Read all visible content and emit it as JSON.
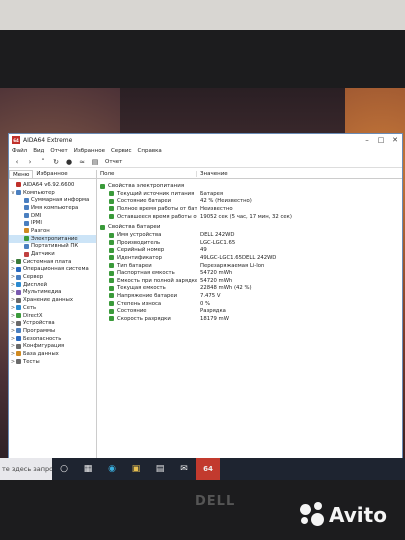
{
  "window": {
    "title": "AIDA64 Extreme",
    "app_icon_text": "64",
    "minimize": "–",
    "maximize": "□",
    "close": "✕"
  },
  "menu": [
    "Файл",
    "Вид",
    "Отчет",
    "Избранное",
    "Сервис",
    "Справка"
  ],
  "toolbar": {
    "report_label": "Отчет"
  },
  "left_tabs": [
    "Меню",
    "Избранное"
  ],
  "tree": [
    {
      "label": "AIDA64 v6.92.6600",
      "level": 0,
      "expander": "",
      "color": "#c0302a"
    },
    {
      "label": "Компьютер",
      "level": 0,
      "expander": "v",
      "color": "#4a7fc0"
    },
    {
      "label": "Суммарная информа",
      "level": 1,
      "expander": "",
      "color": "#4a7fc0"
    },
    {
      "label": "Имя компьютера",
      "level": 1,
      "expander": "",
      "color": "#4a7fc0"
    },
    {
      "label": "DMI",
      "level": 1,
      "expander": "",
      "color": "#4a7fc0"
    },
    {
      "label": "IPMI",
      "level": 1,
      "expander": "",
      "color": "#4a7fc0"
    },
    {
      "label": "Разгон",
      "level": 1,
      "expander": "",
      "color": "#d08a20"
    },
    {
      "label": "Электропитание",
      "level": 1,
      "expander": "",
      "color": "#3a9a3a",
      "selected": true
    },
    {
      "label": "Портативный ПК",
      "level": 1,
      "expander": "",
      "color": "#4a7fc0"
    },
    {
      "label": "Датчики",
      "level": 1,
      "expander": "",
      "color": "#c04040"
    },
    {
      "label": "Системная плата",
      "level": 0,
      "expander": ">",
      "color": "#3a7a3a"
    },
    {
      "label": "Операционная система",
      "level": 0,
      "expander": ">",
      "color": "#2a6ac0"
    },
    {
      "label": "Сервер",
      "level": 0,
      "expander": ">",
      "color": "#4a7fc0"
    },
    {
      "label": "Дисплей",
      "level": 0,
      "expander": ">",
      "color": "#2a8ad0"
    },
    {
      "label": "Мультимедиа",
      "level": 0,
      "expander": ">",
      "color": "#7a5ab0"
    },
    {
      "label": "Хранение данных",
      "level": 0,
      "expander": ">",
      "color": "#6a6a6a"
    },
    {
      "label": "Сеть",
      "level": 0,
      "expander": ">",
      "color": "#2a8ad0"
    },
    {
      "label": "DirectX",
      "level": 0,
      "expander": ">",
      "color": "#3a9a3a"
    },
    {
      "label": "Устройства",
      "level": 0,
      "expander": ">",
      "color": "#6a6a6a"
    },
    {
      "label": "Программы",
      "level": 0,
      "expander": ">",
      "color": "#4a7fc0"
    },
    {
      "label": "Безопасность",
      "level": 0,
      "expander": ">",
      "color": "#2a6ac0"
    },
    {
      "label": "Конфигурация",
      "level": 0,
      "expander": ">",
      "color": "#6a6a6a"
    },
    {
      "label": "База данных",
      "level": 0,
      "expander": ">",
      "color": "#d08a20"
    },
    {
      "label": "Тесты",
      "level": 0,
      "expander": ">",
      "color": "#6a6a6a"
    }
  ],
  "columns": {
    "field": "Поле",
    "value": "Значение"
  },
  "sections": [
    {
      "title": "Свойства электропитания",
      "rows": [
        {
          "field": "Текущий источник питания",
          "value": "Батарея"
        },
        {
          "field": "Состояние батареи",
          "value": "42 % (Неизвестно)"
        },
        {
          "field": "Полное время работы от бат",
          "value": "Неизвестно"
        },
        {
          "field": "Оставшееся время работы от",
          "value": "19052 сек (5 час, 17 мин, 32 сек)"
        }
      ]
    },
    {
      "title": "Свойства батареи",
      "rows": [
        {
          "field": "Имя устройства",
          "value": "DELL 242WD"
        },
        {
          "field": "Производитель",
          "value": "LGC-LGC1.65"
        },
        {
          "field": "Серийный номер",
          "value": "49"
        },
        {
          "field": "Идентификатор",
          "value": "49LGC-LGC1.65DELL 242WD"
        },
        {
          "field": "Тип батареи",
          "value": "Перезаряжаемая Li-Ion"
        },
        {
          "field": "Паспортная емкость",
          "value": "54720 mWh"
        },
        {
          "field": "Емкость при полной зарядке",
          "value": "54720 mWh"
        },
        {
          "field": "Текущая емкость",
          "value": "22848 mWh (42 %)"
        },
        {
          "field": "Напряжение батареи",
          "value": "7.475 V"
        },
        {
          "field": "Степень износа",
          "value": "0 %"
        },
        {
          "field": "Состояние",
          "value": "Разрядка"
        },
        {
          "field": "Скорость разрядки",
          "value": "18179 mW"
        }
      ]
    }
  ],
  "taskbar": {
    "search_text": "те здесь запрос",
    "aida_label": "64"
  },
  "brand": {
    "laptop": "DELL",
    "watermark": "Avito"
  }
}
